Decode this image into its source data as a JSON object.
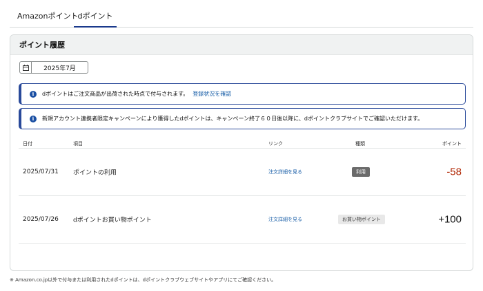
{
  "tabs": [
    {
      "label": "Amazonポイント",
      "active": false
    },
    {
      "label": "dポイント",
      "active": true
    }
  ],
  "card": {
    "title": "ポイント履歴",
    "month_picker": {
      "icon": "calendar-icon",
      "value": "2025年7月"
    }
  },
  "alerts": [
    {
      "icon": "info-icon",
      "text": "dポイントはご注文商品が出荷された時点で付与されます。",
      "link": "登録状況を確認"
    },
    {
      "icon": "info-icon",
      "text": "新規アカウント連携者限定キャンペーンにより獲得したdポイントは、キャンペーン終了６０日後以降に、dポイントクラブサイトでご確認いただけます。"
    }
  ],
  "table": {
    "headers": {
      "date": "日付",
      "item": "項目",
      "link": "リンク",
      "type": "種類",
      "points": "ポイント"
    },
    "rows": [
      {
        "date": "2025/07/31",
        "item": "ポイントの利用",
        "link": "注文詳細を見る",
        "type": "利用",
        "points": "-58"
      },
      {
        "date": "2025/07/26",
        "item": "dポイントお買い物ポイント",
        "link": "注文詳細を見る",
        "type": "お買い物ポイント",
        "points": "+100"
      }
    ]
  },
  "footnote": "※ Amazon.co.jp以外で付与または利用されたdポイントは、dポイントクラブウェブサイトやアプリにてご確認ください。",
  "colors": {
    "accent": "#1a3a8c",
    "negative": "#b12704",
    "link": "#1a5fa8"
  }
}
